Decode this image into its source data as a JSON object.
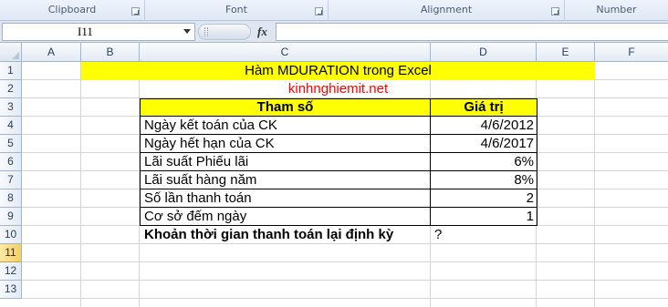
{
  "ribbon": {
    "groups": [
      {
        "label": "Clipboard"
      },
      {
        "label": "Font"
      },
      {
        "label": "Alignment"
      },
      {
        "label": "Number"
      }
    ]
  },
  "formula_bar": {
    "name_box": "I11",
    "fx_label": "fx",
    "formula": ""
  },
  "columns": [
    "A",
    "B",
    "C",
    "D",
    "E",
    "F"
  ],
  "rows": [
    "1",
    "2",
    "3",
    "4",
    "5",
    "6",
    "7",
    "8",
    "9",
    "10",
    "11",
    "12",
    "13"
  ],
  "active_row": "11",
  "sheet": {
    "title": "Hàm MDURATION trong Excel",
    "site": "kinhnghiemit.net",
    "header": {
      "param": "Tham số",
      "value": "Giá trị"
    },
    "params": [
      {
        "label": "Ngày kết toán của CK",
        "value": "4/6/2012"
      },
      {
        "label": "Ngày hết hạn của CK",
        "value": "4/6/2017"
      },
      {
        "label": "Lãi suất Phiếu lãi",
        "value": "6%"
      },
      {
        "label": "Lãi suất hàng năm",
        "value": "8%"
      },
      {
        "label": "Số lần thanh toán",
        "value": "2"
      },
      {
        "label": "Cơ sở đếm ngày",
        "value": "1"
      }
    ],
    "result_label": "Khoản thời gian thanh toán lại định kỳ",
    "result_value": "?"
  },
  "colors": {
    "highlight": "#ffff00",
    "site_text": "#ff0000"
  }
}
